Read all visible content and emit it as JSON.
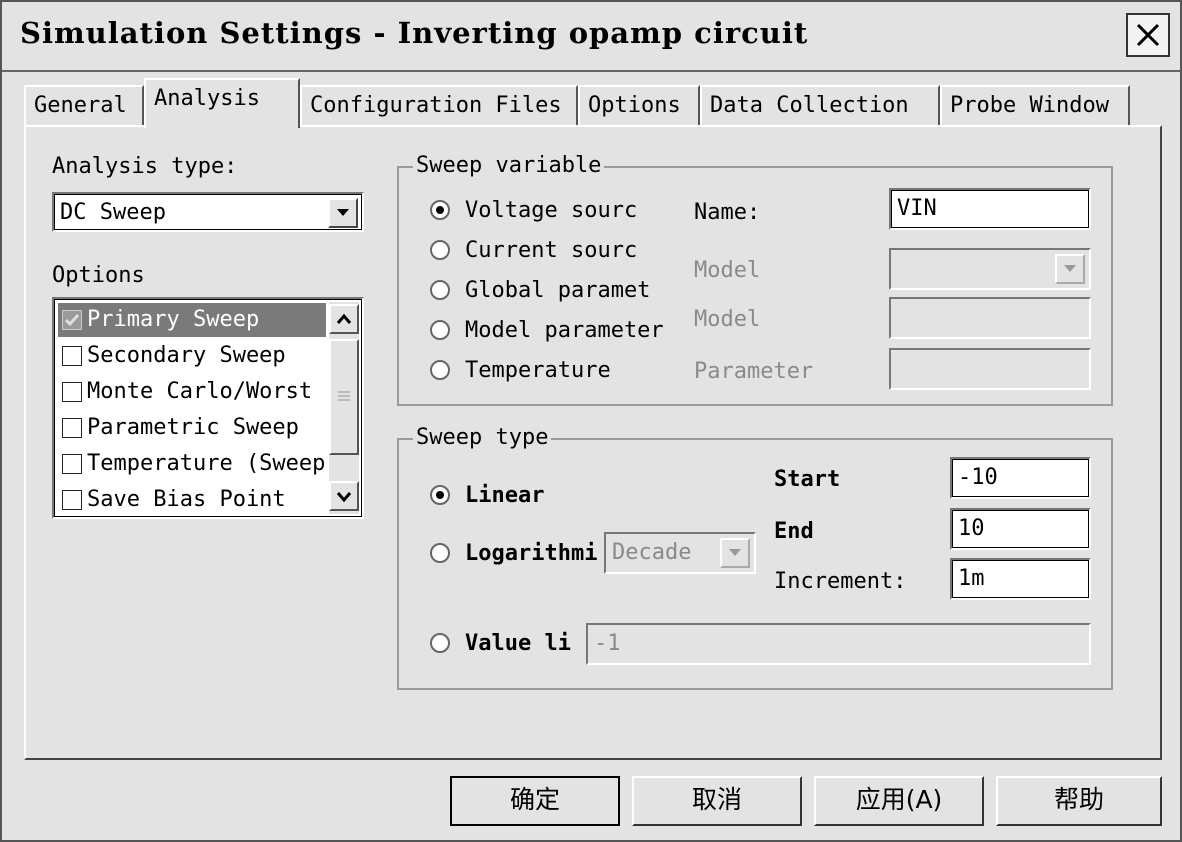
{
  "window": {
    "title": "Simulation Settings - Inverting opamp circuit"
  },
  "tabs": [
    "General",
    "Analysis",
    "Configuration Files",
    "Options",
    "Data Collection",
    "Probe Window"
  ],
  "analysis": {
    "type_label": "Analysis type:",
    "type_value": "DC Sweep",
    "options_label": "Options",
    "options": [
      {
        "label": "Primary Sweep",
        "checked": true,
        "selected": true
      },
      {
        "label": "Secondary Sweep",
        "checked": false
      },
      {
        "label": "Monte Carlo/Worst",
        "checked": false
      },
      {
        "label": "Parametric Sweep",
        "checked": false
      },
      {
        "label": "Temperature (Sweep",
        "checked": false
      },
      {
        "label": "Save Bias Point",
        "checked": false
      }
    ]
  },
  "sweep_variable": {
    "caption": "Sweep variable",
    "radios": [
      "Voltage sourc",
      "Current sourc",
      "Global paramet",
      "Model parameter",
      "Temperature"
    ],
    "selected": 0,
    "name_label": "Name:",
    "name_value": "VIN",
    "model_type_label": "Model",
    "model_name_label": "Model",
    "parameter_label": "Parameter"
  },
  "sweep_type": {
    "caption": "Sweep type",
    "radios": [
      "Linear",
      "Logarithmi",
      "Value li"
    ],
    "selected": 0,
    "log_unit": "Decade",
    "start_label": "Start",
    "start_value": "-10",
    "end_label": "End",
    "end_value": "10",
    "increment_label": "Increment:",
    "increment_value": "1m",
    "value_list": "-1"
  },
  "buttons": {
    "ok": "确定",
    "cancel": "取消",
    "apply": "应用(A)",
    "help": "帮助"
  }
}
